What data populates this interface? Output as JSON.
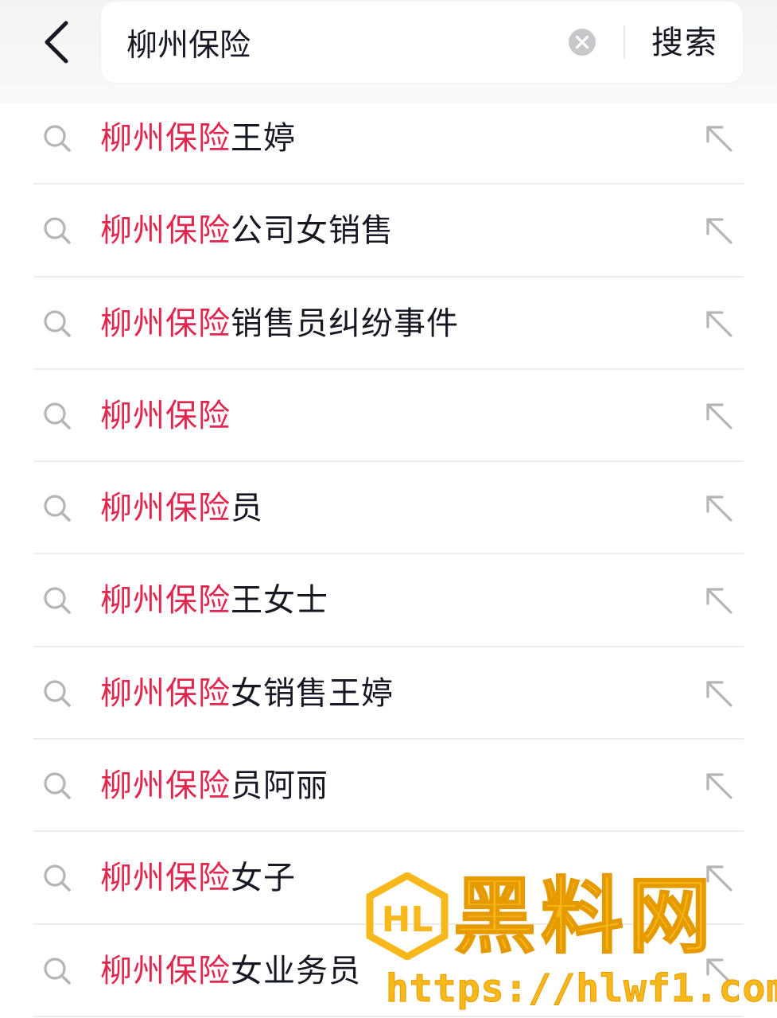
{
  "search": {
    "query": "柳州保险",
    "button_label": "搜索"
  },
  "icons": {
    "back": "chevron-left-icon",
    "clear": "clear-circle-icon",
    "suggestion_search": "search-icon",
    "fill_query": "arrow-up-left-icon"
  },
  "colors": {
    "highlight": "#e2264d",
    "text": "#161823",
    "icon_gray": "#b5b5b5"
  },
  "suggestions": [
    {
      "highlight": "柳州保险",
      "rest": "王婷"
    },
    {
      "highlight": "柳州保险",
      "rest": "公司女销售"
    },
    {
      "highlight": "柳州保险",
      "rest": "销售员纠纷事件"
    },
    {
      "highlight": "柳州保险",
      "rest": ""
    },
    {
      "highlight": "柳州保险",
      "rest": "员"
    },
    {
      "highlight": "柳州保险",
      "rest": "王女士"
    },
    {
      "highlight": "柳州保险",
      "rest": "女销售王婷"
    },
    {
      "highlight": "柳州保险",
      "rest": "员阿丽"
    },
    {
      "highlight": "柳州保险",
      "rest": "女子"
    },
    {
      "highlight": "柳州保险",
      "rest": "女业务员"
    }
  ],
  "watermark": {
    "title": "黑料网",
    "url": "https://hlwf1.com"
  }
}
